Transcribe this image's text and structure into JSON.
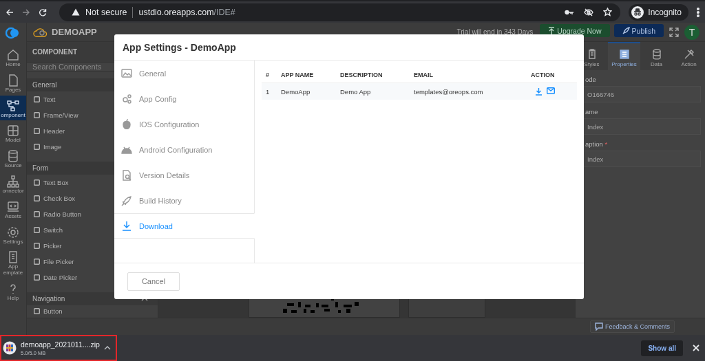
{
  "browser": {
    "security": "Not secure",
    "url_host": "ustdio.oreapps.com",
    "url_path": "/IDE#",
    "profile": "Incognito"
  },
  "app": {
    "name": "DEMOAPP",
    "trial": "Trial will end in 343 Days",
    "upgrade": "Upgrade Now",
    "publish": "Publish",
    "avatar": "T",
    "rail": [
      {
        "label": "Home",
        "selected": false
      },
      {
        "label": "Pages",
        "selected": false
      },
      {
        "label": "omponent",
        "selected": true
      },
      {
        "label": "Model",
        "selected": false
      },
      {
        "label": "Source",
        "selected": false
      },
      {
        "label": "onnector",
        "selected": false
      },
      {
        "label": "Assets",
        "selected": false
      },
      {
        "label": "Settings",
        "selected": false
      },
      {
        "label": "App emplate",
        "selected": false
      },
      {
        "label": "Help",
        "selected": false
      }
    ],
    "components": {
      "title": "COMPONENT",
      "search_placeholder": "Search Components",
      "sections": [
        {
          "title": "General",
          "items": [
            "Text",
            "Frame/View",
            "Header",
            "Image"
          ]
        },
        {
          "title": "Form",
          "items": [
            "Text Box",
            "Check Box",
            "Radio Button",
            "Switch",
            "Picker",
            "File Picker",
            "Date Picker"
          ]
        },
        {
          "title": "Navigation",
          "expanded": true,
          "items": [
            "Button"
          ]
        }
      ]
    },
    "properties": {
      "tabs": [
        {
          "label": "Styles",
          "selected": false
        },
        {
          "label": "Properties",
          "selected": true
        },
        {
          "label": "Data",
          "selected": false
        },
        {
          "label": "Action",
          "selected": false
        }
      ],
      "fields": [
        {
          "label": "ode",
          "value": "O166746"
        },
        {
          "label": "ame",
          "value": "Index"
        },
        {
          "label": "aption",
          "required_mark": "*",
          "value": "Index"
        }
      ]
    },
    "feedback": "Feedback & Comments"
  },
  "modal": {
    "title": "App Settings - DemoApp",
    "nav": [
      {
        "label": "General",
        "selected": false
      },
      {
        "label": "App Config",
        "selected": false
      },
      {
        "label": "IOS Configuration",
        "selected": false
      },
      {
        "label": "Android Configuration",
        "selected": false
      },
      {
        "label": "Version Details",
        "selected": false
      },
      {
        "label": "Build History",
        "selected": false
      },
      {
        "label": "Download",
        "selected": true
      }
    ],
    "table": {
      "columns": [
        "#",
        "APP NAME",
        "DESCRIPTION",
        "EMAIL",
        "ACTION"
      ],
      "rows": [
        {
          "cells": [
            "1",
            "DemoApp",
            "Demo App",
            "templates@oreops.com"
          ]
        }
      ]
    },
    "cancel": "Cancel"
  },
  "downloads": {
    "file": "demoapp_2021011....zip",
    "size": "5.0/5.0 MB",
    "highlighted": true,
    "show_all": "Show all"
  }
}
